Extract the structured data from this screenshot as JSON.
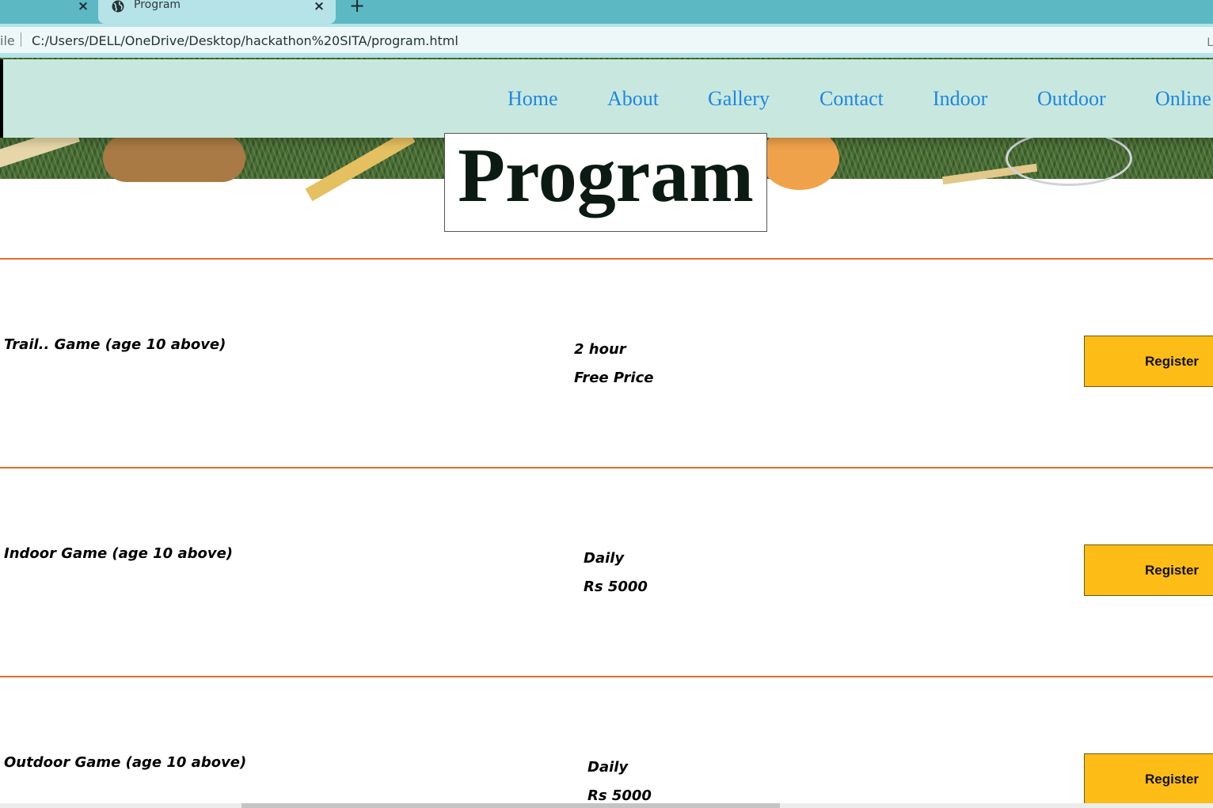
{
  "browser": {
    "tabs": [
      {
        "label": ""
      },
      {
        "label": "Program"
      }
    ],
    "address": {
      "scheme_fragment": "ile",
      "url": "C:/Users/DELL/OneDrive/Desktop/hackathon%20SITA/program.html",
      "edge_fragment": "L"
    }
  },
  "nav": {
    "items": [
      "Home",
      "About",
      "Gallery",
      "Contact",
      "Indoor",
      "Outdoor",
      "Online"
    ],
    "link_color": "#1f86e0",
    "background": "#c8e8df"
  },
  "page": {
    "title": "Program"
  },
  "programs": [
    {
      "name": "Trail.. Game (age 10 above)",
      "line1": "2 hour",
      "line2": "Free Price",
      "button": "Register"
    },
    {
      "name": "Indoor Game (age 10 above)",
      "line1": "Daily",
      "line2": "Rs 5000",
      "button": "Register"
    },
    {
      "name": "Outdoor Game (age 10 above)",
      "line1": "Daily",
      "line2": "Rs 5000",
      "button": "Register"
    }
  ],
  "colors": {
    "accent_rule": "#e46a2a",
    "register_button": "#fdbd16",
    "tab_strip": "#5cb8c2"
  }
}
